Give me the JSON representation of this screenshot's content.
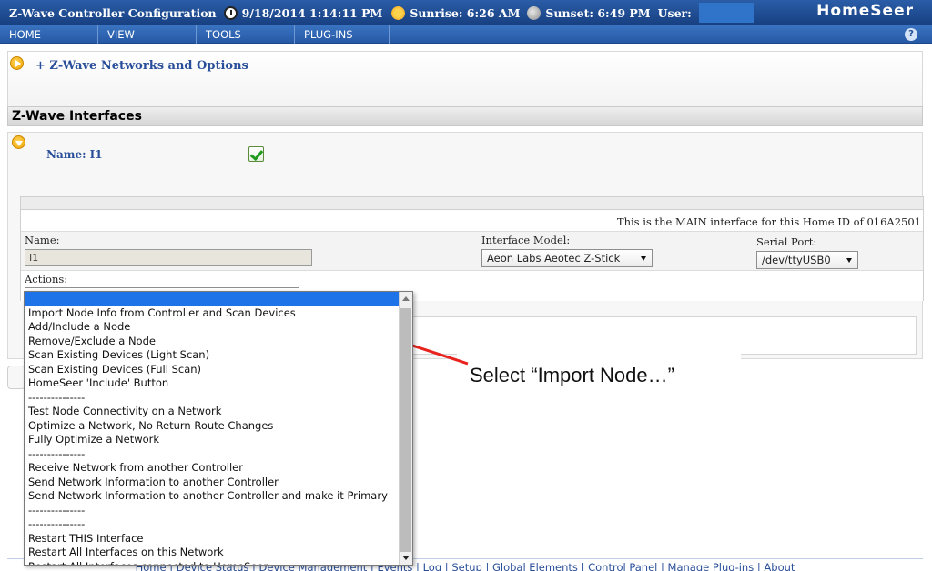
{
  "header": {
    "title": "Z-Wave Controller Configuration",
    "datetime": "9/18/2014 1:14:11 PM",
    "sunrise": "Sunrise: 6:26 AM",
    "sunset": "Sunset: 6:49 PM",
    "user_label": "User:",
    "logo": "HomeSeer"
  },
  "menu": [
    "HOME",
    "VIEW",
    "TOOLS",
    "PLUG-INS"
  ],
  "networks": {
    "link": "+ Z-Wave Networks and Options"
  },
  "interfaces": {
    "header": "Z-Wave Interfaces",
    "name_heading": "Name: I1",
    "main_note": "This is the MAIN interface for this Home ID of 016A2501",
    "name_label": "Name:",
    "name_value": "I1",
    "model_label": "Interface Model:",
    "model_value": "Aeon Labs Aeotec Z-Stick",
    "port_label": "Serial Port:",
    "port_value": "/dev/ttyUSB0",
    "actions_label": "Actions:",
    "actions_value": ""
  },
  "actions_options": [
    "",
    "Import Node Info from Controller and Scan Devices",
    "Add/Include a Node",
    "Remove/Exclude a Node",
    "Scan Existing Devices (Light Scan)",
    "Scan Existing Devices (Full Scan)",
    "HomeSeer 'Include' Button",
    "---------------",
    "Test Node Connectivity on a Network",
    "Optimize a Network, No Return Route Changes",
    "Fully Optimize a Network",
    "---------------",
    "Receive Network from another Controller",
    "Send Network Information to another Controller",
    "Send Network Information to another Controller and make it Primary",
    "---------------",
    "---------------",
    "Restart THIS Interface",
    "Restart All Interfaces on this Network",
    "Restart All Interfaces connected to HomeSeer"
  ],
  "callout": {
    "text": "Select “Import Node…”",
    "arrow_color": "#e8221d"
  },
  "footer": {
    "links": "Home | Device Status | Device Management | Events | Log | Setup | Global Elements | Control Panel | Manage Plug-ins | About"
  },
  "colors": {
    "header_blue": "#173f80",
    "link_blue": "#2a4f9a",
    "selected_option": "#1e73e8"
  }
}
